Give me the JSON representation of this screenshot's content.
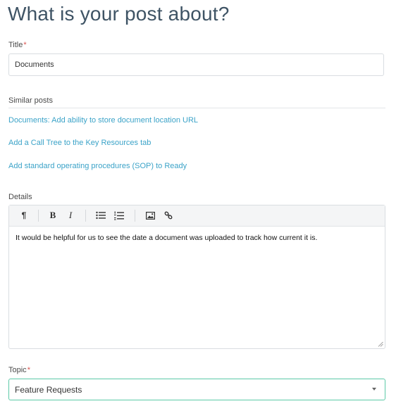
{
  "page": {
    "title": "What is your post about?"
  },
  "title_field": {
    "label": "Title",
    "required_mark": "*",
    "value": "Documents"
  },
  "similar_posts": {
    "label": "Similar posts",
    "items": [
      "Documents: Add ability to store document location URL",
      "Add a Call Tree to the Key Resources tab",
      "Add standard operating procedures (SOP) to Ready"
    ]
  },
  "details": {
    "label": "Details",
    "toolbar": {
      "paragraph_glyph": "¶",
      "bold_glyph": "B",
      "italic_glyph": "I"
    },
    "body": "It would be helpful for us to see the date a document was uploaded to track how current it is."
  },
  "topic": {
    "label": "Topic",
    "required_mark": "*",
    "value": "Feature Requests"
  },
  "colors": {
    "title": "#3f5465",
    "link": "#3ba3c8",
    "required": "#d9534f",
    "focus_border": "#5cc9a7"
  }
}
